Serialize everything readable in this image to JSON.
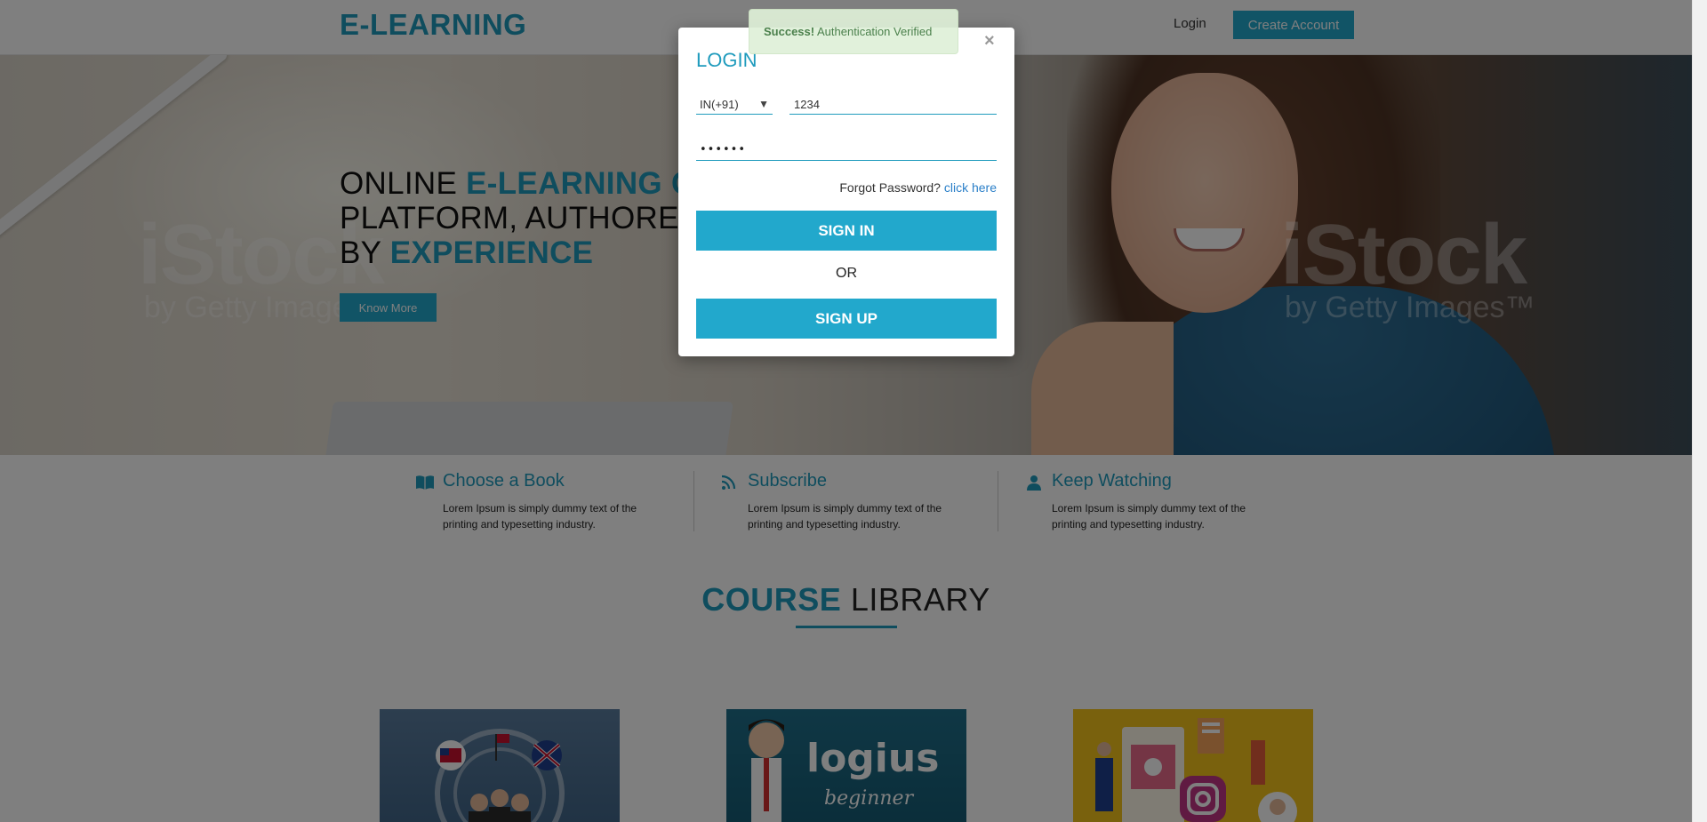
{
  "header": {
    "brand": "E-LEARNING",
    "login_label": "Login",
    "create_account_label": "Create Account"
  },
  "hero": {
    "heading_line1_plain": "ONLINE ",
    "heading_line1_accent": "E-LEARNING COURSE",
    "heading_line2": "PLATFORM, AUTHORED",
    "heading_line3_plain": "BY ",
    "heading_line3_accent": "EXPERIENCE",
    "button_label": "Know More",
    "watermark_left": "iStock",
    "watermark_left_sub": "by Getty Images",
    "watermark_right": "iStock",
    "watermark_right_sub": "by Getty Images™"
  },
  "features": [
    {
      "icon": "book-icon",
      "title": "Choose a Book",
      "text": "Lorem Ipsum is simply dummy text of the printing and typesetting industry."
    },
    {
      "icon": "rss-icon",
      "title": "Subscribe",
      "text": "Lorem Ipsum is simply dummy text of the printing and typesetting industry."
    },
    {
      "icon": "user-icon",
      "title": "Keep Watching",
      "text": "Lorem Ipsum is simply dummy text of the printing and typesetting industry."
    }
  ],
  "library": {
    "title_accent": "COURSE",
    "title_plain": " LIBRARY",
    "card2_brand": "logius",
    "card2_sub": "beginner"
  },
  "modal": {
    "title": "LOGIN",
    "close_label": "×",
    "country_code": "IN(+91)",
    "phone_value": "1234",
    "password_value": "••••••",
    "forgot_text": "Forgot Password? ",
    "forgot_link": "click here",
    "signin_label": "SIGN IN",
    "or_text": "OR",
    "signup_label": "SIGN UP"
  },
  "toast": {
    "strong": "Success!",
    "message": " Authentication Verified"
  },
  "colors": {
    "accent": "#1f9bbd",
    "button": "#22a8cc",
    "toast_bg": "#dff0d8",
    "toast_text": "#3c763d",
    "link": "#2a7fc8"
  }
}
